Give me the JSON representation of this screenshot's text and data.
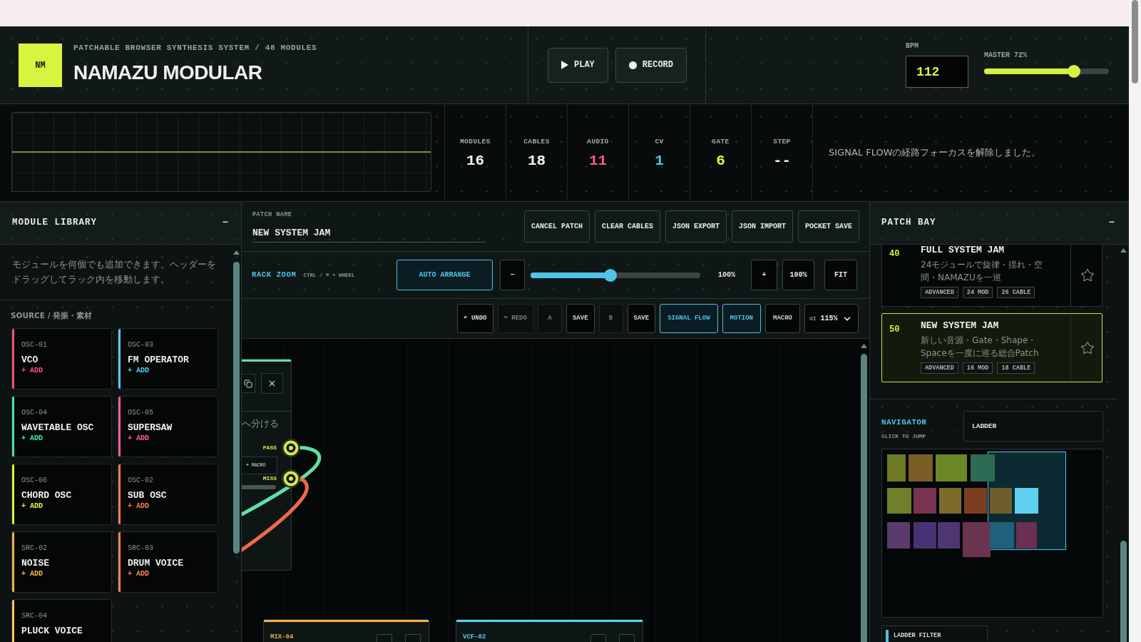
{
  "brand": {
    "logo": "NM",
    "subtitle": "PATCHABLE BROWSER SYNTHESIS SYSTEM / 48 MODULES",
    "title": "NAMAZU MODULAR"
  },
  "transport": [
    {
      "kind": "play",
      "label": "PLAY"
    },
    {
      "kind": "record",
      "label": "RECORD"
    }
  ],
  "bpm": {
    "label": "BPM",
    "value": "112"
  },
  "master": {
    "label": "MASTER 72%",
    "level": 0.72
  },
  "stats": [
    {
      "label": "MODULES",
      "value": "16",
      "color": "#f2f5f0"
    },
    {
      "label": "CABLES",
      "value": "18",
      "color": "#f2f5f0"
    },
    {
      "label": "AUDIO",
      "value": "11",
      "color": "#ff5a86"
    },
    {
      "label": "CV",
      "value": "1",
      "color": "#4cc6ef"
    },
    {
      "label": "GATE",
      "value": "6",
      "color": "#d9f542"
    },
    {
      "label": "STEP",
      "value": "--",
      "color": "#f2f5f0"
    }
  ],
  "status_message": "SIGNAL FLOWの経路フォーカスを解除しました。",
  "library": {
    "title": "MODULE LIBRARY",
    "collapse": "−",
    "description": "モジュールを何個でも追加できます。ヘッダーをドラッグしてラック内を移動します。",
    "section": "SOURCE / 発振・素材",
    "modules": [
      {
        "code": "OSC-01",
        "name": "VCO",
        "add": "+ ADD",
        "color": "#ff4f7b"
      },
      {
        "code": "OSC-03",
        "name": "FM OPERATOR",
        "add": "+ ADD",
        "color": "#4fd0f0"
      },
      {
        "code": "OSC-04",
        "name": "WAVETABLE OSC",
        "add": "+ ADD",
        "color": "#4fe0b0"
      },
      {
        "code": "OSC-05",
        "name": "SUPERSAW",
        "add": "+ ADD",
        "color": "#ff5fa0"
      },
      {
        "code": "OSC-06",
        "name": "CHORD OSC",
        "add": "+ ADD",
        "color": "#d9f542"
      },
      {
        "code": "OSC-02",
        "name": "SUB OSC",
        "add": "+ ADD",
        "color": "#ff7a50"
      },
      {
        "code": "SRC-02",
        "name": "NOISE",
        "add": "+ ADD",
        "color": "#ffb04f"
      },
      {
        "code": "SRC-03",
        "name": "DRUM VOICE",
        "add": "+ ADD",
        "color": "#ff8450"
      },
      {
        "code": "SRC-04",
        "name": "PLUCK VOICE",
        "color": "#ffc457"
      }
    ]
  },
  "patch": {
    "label": "PATCH NAME",
    "value": "NEW SYSTEM JAM",
    "actions": [
      "CANCEL PATCH",
      "CLEAR CABLES",
      "JSON EXPORT",
      "JSON IMPORT",
      "POCKET SAVE"
    ]
  },
  "zoom": {
    "label": "RACK ZOOM",
    "hint": "CTRL / ⌘ + WHEEL",
    "auto_arrange": "AUTO ARRANGE",
    "zoom_out": "−",
    "level": 0.47,
    "reading": "100%",
    "zoom_in": "+",
    "reset": "100%",
    "fit": "FIT"
  },
  "toolbar": [
    {
      "kind": "action",
      "label": "↶ UNDO",
      "disabled": false
    },
    {
      "kind": "action",
      "label": "↷ REDO",
      "disabled": true
    },
    {
      "kind": "slot",
      "label": "A",
      "disabled": true
    },
    {
      "kind": "action",
      "label": "SAVE",
      "disabled": false
    },
    {
      "kind": "slot",
      "label": "B",
      "disabled": true
    },
    {
      "kind": "action",
      "label": "SAVE",
      "disabled": false
    },
    {
      "kind": "toggle",
      "label": "SIGNAL FLOW",
      "on": true
    },
    {
      "kind": "toggle",
      "label": "MOTION",
      "on": true
    },
    {
      "kind": "toggle",
      "label": "MACRO",
      "on": false
    },
    {
      "kind": "select",
      "label": "UI",
      "value": "115%"
    }
  ],
  "canvas": {
    "partial_module": {
      "color": "#5ee0a6",
      "text": "へ分ける",
      "ports": [
        {
          "label": "PASS"
        },
        {
          "label": "MISS"
        }
      ],
      "macro": "+ MACRO"
    },
    "cables": [
      {
        "color": "#5ee0a6"
      },
      {
        "color": "#f0694a"
      }
    ],
    "modules": [
      {
        "code": "MIX-04",
        "color": "#f5a94a"
      },
      {
        "code": "VCF-02",
        "color": "#5ccfee"
      }
    ]
  },
  "patch_bay": {
    "title": "PATCH BAY",
    "collapse": "−",
    "patches": [
      {
        "number": "40",
        "name": "FULL SYSTEM JAM",
        "description": "24モジュールで旋律・揺れ・空間・NAMAZUを一巡",
        "tags": [
          "ADVANCED",
          "24 MOD",
          "26 CABLE"
        ],
        "selected": false,
        "favorite": false
      },
      {
        "number": "50",
        "name": "NEW SYSTEM JAM",
        "description": "新しい音源・Gate・Shape・Spaceを一度に巡る総合Patch",
        "tags": [
          "ADVANCED",
          "16 MOD",
          "18 CABLE"
        ],
        "selected": true,
        "favorite": false
      }
    ]
  },
  "navigator": {
    "title": "NAVIGATOR",
    "hint": "CLICK TO JUMP",
    "search": "LADDER",
    "tiles": [
      {
        "color": "#6e7a24"
      },
      {
        "color": "#7a5e26"
      },
      {
        "color": "#6b8726"
      },
      {
        "color": "#2d6b55"
      },
      {
        "color": "#6f7f2c"
      },
      {
        "color": "#7a3252"
      },
      {
        "color": "#7b6a2a"
      },
      {
        "color": "#7a3f22"
      },
      {
        "color": "#6e5e2e"
      },
      {
        "color": "#5fd0f0"
      },
      {
        "color": "#5a3b6e"
      },
      {
        "color": "#483275"
      },
      {
        "color": "#4d3672"
      },
      {
        "color": "#6b344e"
      },
      {
        "color": "#21607a"
      },
      {
        "color": "#6a2f52"
      }
    ],
    "results": [
      {
        "name": "LADDER FILTER"
      }
    ]
  }
}
